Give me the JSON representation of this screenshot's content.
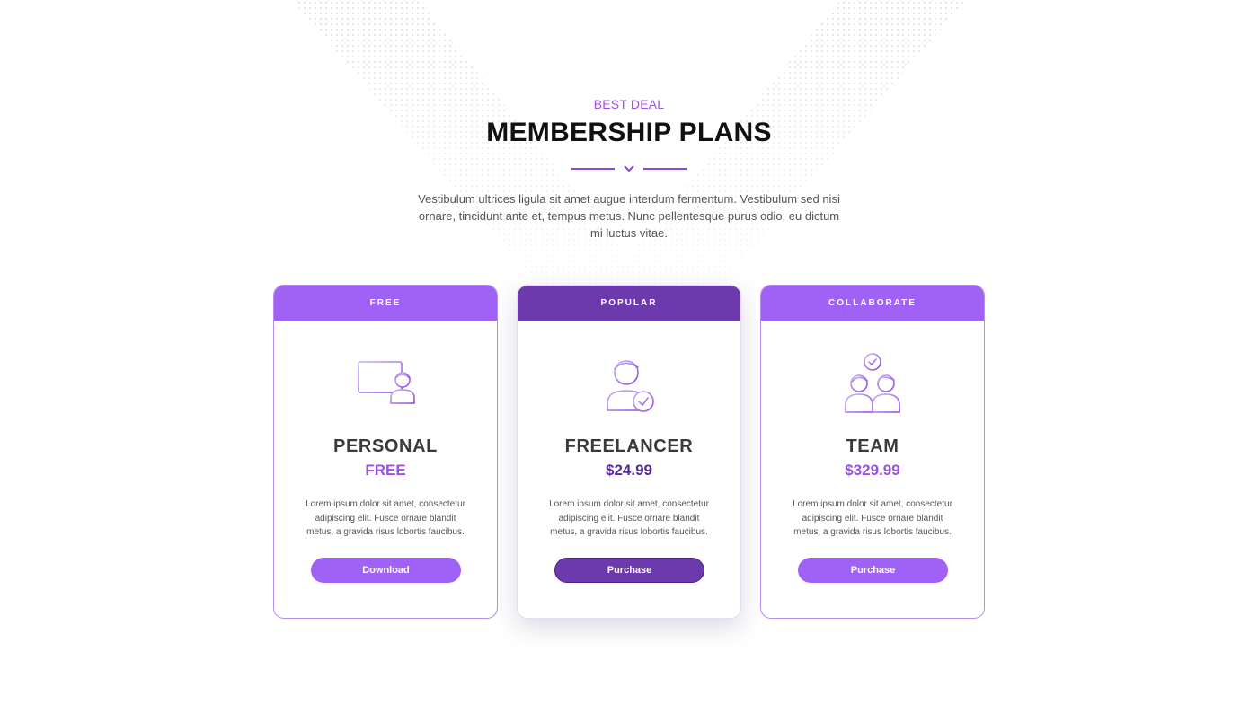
{
  "header": {
    "eyebrow": "BEST DEAL",
    "title": "MEMBERSHIP PLANS",
    "intro": "Vestibulum ultrices ligula sit amet augue interdum fermentum. Vestibulum sed nisi ornare, tincidunt ante et, tempus metus. Nunc pellentesque purus odio, eu dictum mi luctus vitae."
  },
  "colors": {
    "accent": "#9b51e0",
    "accent_light": "#a061f5",
    "accent_dark": "#6c3aac",
    "title": "#111111",
    "text": "#555555",
    "dots": "#dcdcdc"
  },
  "plans": [
    {
      "tag": "FREE",
      "icon": "computer-user-icon",
      "name": "PERSONAL",
      "price": "FREE",
      "description": "Lorem ipsum dolor sit amet, consectetur adipiscing elit. Fusce ornare blandit metus, a gravida risus lobortis faucibus.",
      "button_label": "Download",
      "header_color": "#a061f5",
      "button_color": "#a061f5",
      "price_color": "#9b51e0"
    },
    {
      "tag": "POPULAR",
      "icon": "verified-user-icon",
      "name": "FREELANCER",
      "price": "$24.99",
      "description": "Lorem ipsum dolor sit amet, consectetur adipiscing elit. Fusce ornare blandit metus, a gravida risus lobortis faucibus.",
      "button_label": "Purchase",
      "header_color": "#6c3aac",
      "button_color": "#6c3aac",
      "price_color": "#5a2a9a"
    },
    {
      "tag": "COLLABORATE",
      "icon": "team-icon",
      "name": "TEAM",
      "price": "$329.99",
      "description": "Lorem ipsum dolor sit amet, consectetur adipiscing elit. Fusce ornare blandit metus, a gravida risus lobortis faucibus.",
      "button_label": "Purchase",
      "header_color": "#a061f5",
      "button_color": "#a061f5",
      "price_color": "#9b51e0"
    }
  ]
}
